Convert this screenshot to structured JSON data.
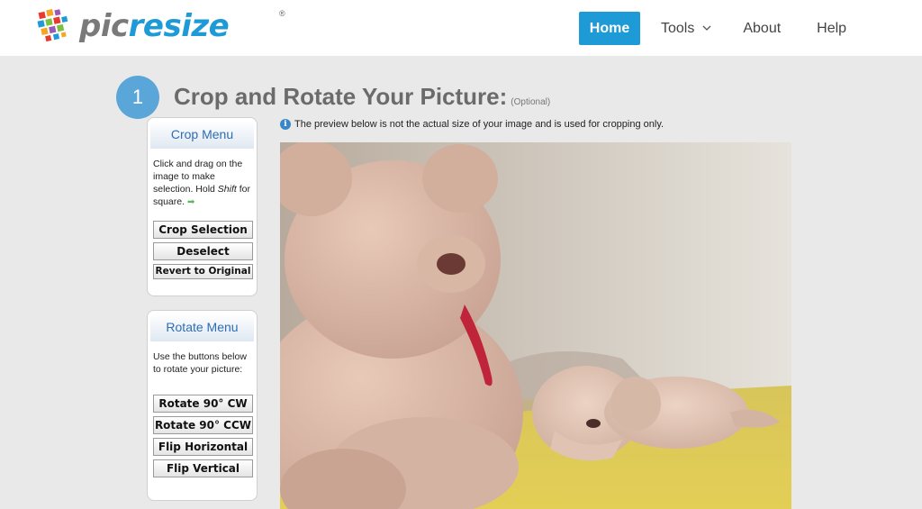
{
  "header": {
    "logo_pic": "pic",
    "logo_resize": "resize",
    "logo_registered": "®",
    "nav": {
      "home": "Home",
      "tools": "Tools",
      "about": "About",
      "help": "Help"
    }
  },
  "step": {
    "number": "1",
    "title": "Crop and Rotate Your Picture:",
    "optional": "(Optional)"
  },
  "notice": "The preview below is not the actual size of your image and is used for cropping only.",
  "crop_menu": {
    "title": "Crop Menu",
    "text_1": "Click and drag on the image to make selection. Hold ",
    "text_shift": "Shift",
    "text_2": " for square.",
    "buttons": {
      "crop": "Crop Selection",
      "deselect": "Deselect",
      "revert": "Revert to Original"
    }
  },
  "rotate_menu": {
    "title": "Rotate Menu",
    "text": "Use the buttons below to rotate your picture:",
    "buttons": {
      "cw": "Rotate 90° CW",
      "ccw": "Rotate 90° CCW",
      "flip_h": "Flip Horizontal",
      "flip_v": "Flip Vertical"
    }
  },
  "colors": {
    "brand_blue": "#1e9ad6",
    "step_blue": "#5aa6d8",
    "menu_title": "#2e6db4"
  }
}
